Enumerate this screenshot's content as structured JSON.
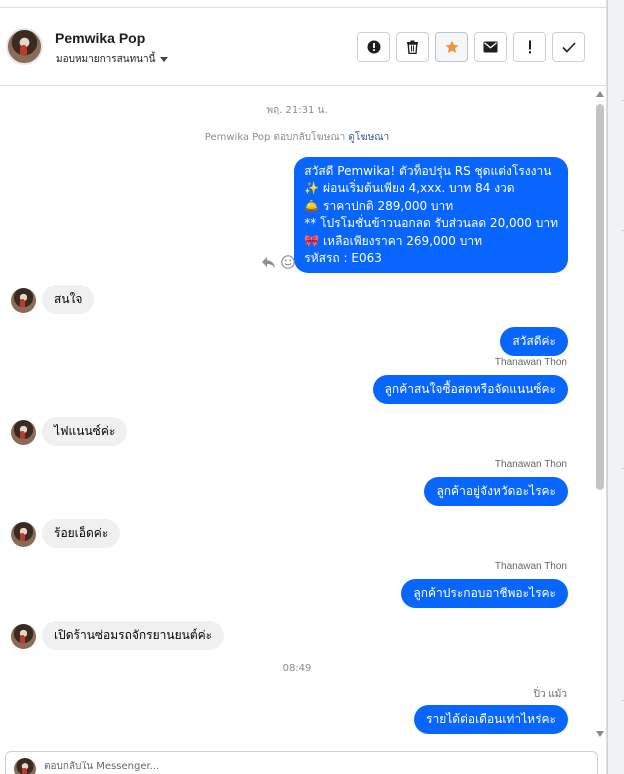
{
  "header": {
    "name": "Pemwika Pop",
    "assign_label": "มอบหมายการสนทนานี้",
    "toolbar": [
      {
        "icon": "alert-circle-icon",
        "label": ""
      },
      {
        "icon": "trash-icon",
        "label": ""
      },
      {
        "icon": "star-icon",
        "label": ""
      },
      {
        "icon": "mail-icon",
        "label": ""
      },
      {
        "icon": "exclamation-icon",
        "label": ""
      },
      {
        "icon": "check-icon",
        "label": ""
      }
    ],
    "star_color": "#f7923a"
  },
  "thread": {
    "timestamp_1": "พฤ. 21:31 น.",
    "ad_reply_prefix": "Pemwika Pop ตอบกลับโฆษณา",
    "ad_reply_link": "ดูโฆษณา",
    "ad_message_lines": [
      "สวัสดี Pemwika! ตัวท็อปรุ่น RS ชุดแต่งโรงงาน",
      "✨  ผ่อนเริ่มต้นเพียง 4,xxx. บาท 84 งวด",
      "🛎️ ราคาปกติ 289,000 บาท",
      "** โปรโมชั่นข้าวนอกลด รับส่วนลด 20,000 บาท",
      "🎀  เหลือเพียงราคา 269,000 บาท",
      " รหัสรถ : E063"
    ],
    "msg_in_1": "สนใจ",
    "msg_out_1": "สวัสดีค่ะ",
    "sender_1": "Thanawan Thon",
    "msg_out_2": "ลูกค้าสนใจซื้อสดหรือจัดแนนซ์คะ",
    "msg_in_2": "ไฟแนนซ์ค่ะ",
    "sender_2": "Thanawan Thon",
    "msg_out_3": "ลูกค้าอยู่จังหวัดอะไรคะ",
    "msg_in_3": "ร้อยเอ็ดค่ะ",
    "sender_3": "Thanawan Thon",
    "msg_out_4": "ลูกค้าประกอบอาชีพอะไรคะ",
    "msg_in_4": "เปิดร้านซ่อมรถจักรยานยนต์ค่ะ",
    "timestamp_2": "08:49",
    "sender_4": "ปิ่ว แม้ว",
    "msg_out_5": "รายได้ต่อเดือนเท่าไหร่คะ"
  },
  "composer": {
    "placeholder": "ตอบกลับใน Messenger..."
  },
  "colors": {
    "outgoing_bubble": "#0866ff",
    "incoming_bubble": "#f0f0f0",
    "link": "#385898"
  }
}
